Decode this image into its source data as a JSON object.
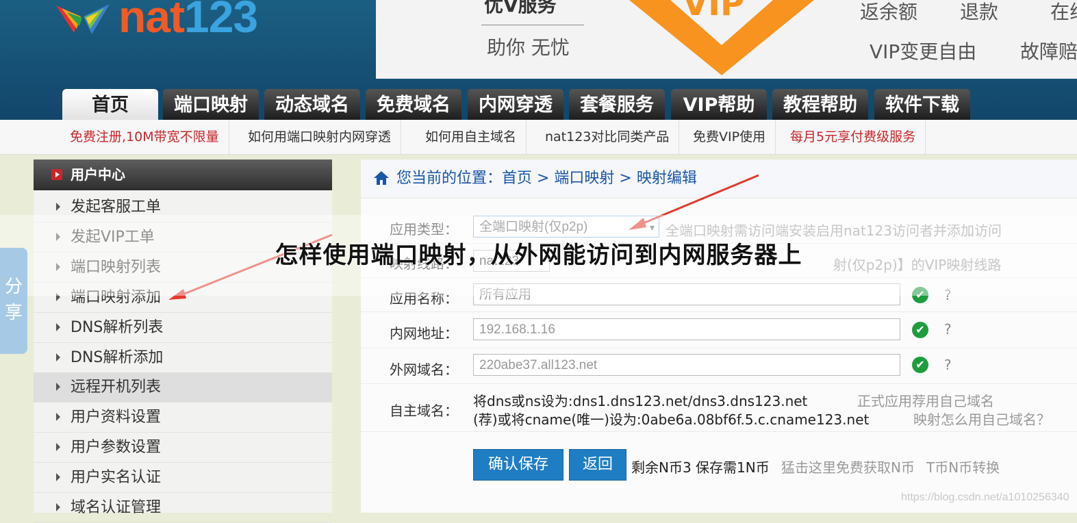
{
  "header": {
    "logo_text_a": "nat",
    "logo_text_b": "123",
    "banner": {
      "text1": "优V服务",
      "text2": "助你 无忧",
      "vip": "VIP",
      "text3": "返余额",
      "text4": "退款",
      "text5": "在线",
      "text6": "VIP变更自由",
      "text7": "故障赔"
    }
  },
  "nav": {
    "tabs": [
      "首页",
      "端口映射",
      "动态域名",
      "免费域名",
      "内网穿透",
      "套餐服务",
      "VIP帮助",
      "教程帮助",
      "软件下载"
    ]
  },
  "subnav": {
    "links": [
      "免费注册,10M带宽不限量",
      "如何用端口映射内网穿透",
      "如何用自主域名",
      "nat123对比同类产品",
      "免费VIP使用",
      "每月5元享付费级服务"
    ]
  },
  "sidebar": {
    "title": "用户中心",
    "items": [
      "发起客服工单",
      "发起VIP工单",
      "端口映射列表",
      "端口映射添加",
      "DNS解析列表",
      "DNS解析添加",
      "远程开机列表",
      "用户资料设置",
      "用户参数设置",
      "用户实名认证",
      "域名认证管理"
    ]
  },
  "main": {
    "breadcrumb": "您当前的位置：首页 > 端口映射 > 映射编辑",
    "form": {
      "app_type_label": "应用类型：",
      "app_type_value": "全端口映射(仅p2p)",
      "app_type_note": "全端口映射需访问端安装启用nat123访问者并添加访问",
      "line_label": "映射线路：",
      "line_value": "nat123",
      "line_note": "射(仅p2p)】的VIP映射线路",
      "app_name_label": "应用名称：",
      "app_name_placeholder": "所有应用",
      "lan_label": "内网地址：",
      "lan_value": "192.168.1.16",
      "wan_label": "外网域名：",
      "wan_value": "220abe37.all123.net",
      "help": "?",
      "custom_label": "自主域名：",
      "custom_line1": "将dns或ns设为:dns1.dns123.net/dns3.dns123.net",
      "custom_line2": "(荐)或将cname(唯一)设为:0abe6a.08bf6f.5.c.cname123.net",
      "custom_note1": "正式应用荐用自己域名",
      "custom_note2": "映射怎么用自己域名？",
      "save_label": "确认保存",
      "back_label": "返回",
      "balance_text": "剩余N币3 保存需1N币",
      "free_link": "猛击这里免费获取N币",
      "convert_link": "T币N币转换"
    }
  },
  "overlay": {
    "title": "怎样使用端口映射，从外网能访问到内网服务器上",
    "share": "分享",
    "watermark": "https://blog.csdn.net/a1010256340"
  },
  "colors": {
    "accent": "#1f7dc4",
    "red": "#c8262b",
    "ok": "#1e9d3e",
    "arrow": "#e23a2e"
  }
}
